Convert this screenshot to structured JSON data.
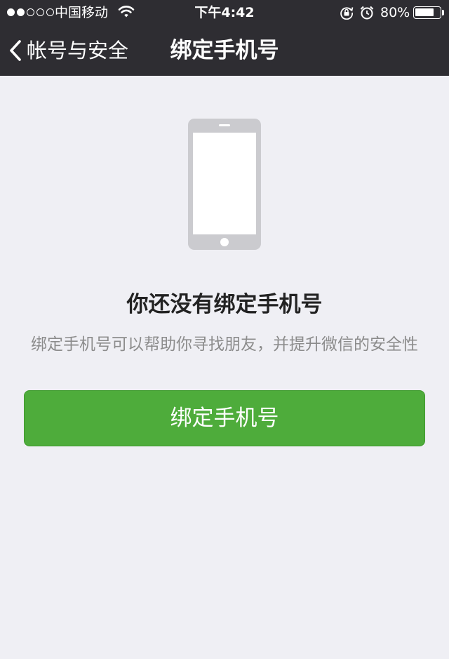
{
  "status_bar": {
    "signal_dots_filled": 2,
    "signal_dots_total": 5,
    "carrier": "中国移动",
    "time": "下午4:42",
    "battery_percent_text": "80%",
    "battery_level": 0.8
  },
  "nav": {
    "back_label": "帐号与安全",
    "title": "绑定手机号"
  },
  "content": {
    "headline": "你还没有绑定手机号",
    "description": "绑定手机号可以帮助你寻找朋友，并提升微信的安全性",
    "button_label": "绑定手机号"
  },
  "colors": {
    "header_background": "#2e2d32",
    "page_background": "#efeff4",
    "button_green": "#4eac3b",
    "illustration_gray": "#cbcbcf"
  },
  "icons": {
    "signal": "signal-dots-icon",
    "wifi": "wifi-icon",
    "rotation_lock": "rotation-lock-icon",
    "alarm": "alarm-icon",
    "battery": "battery-icon",
    "back": "chevron-left-icon",
    "illustration": "smartphone-icon"
  }
}
